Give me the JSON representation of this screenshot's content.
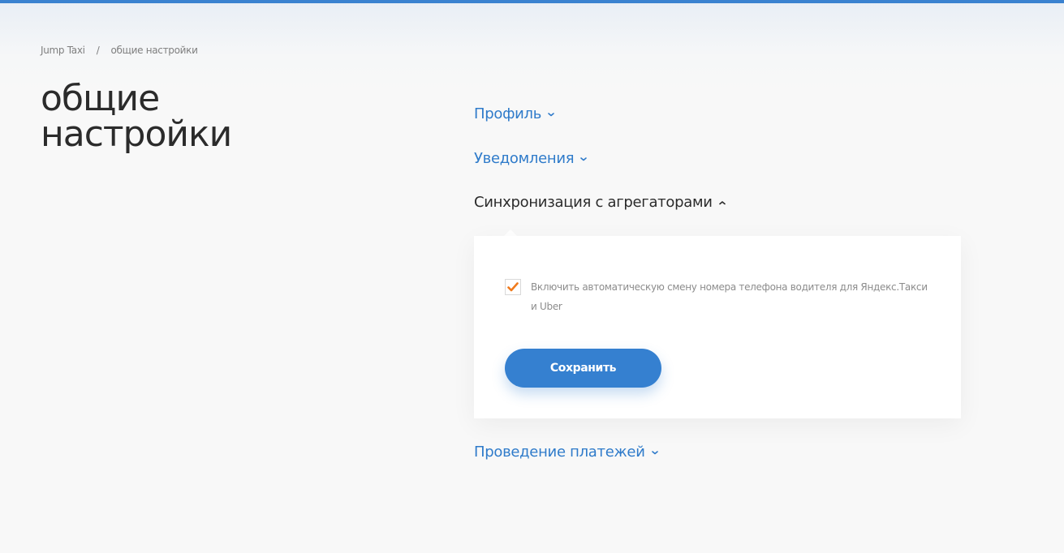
{
  "breadcrumb": {
    "root": "Jump Taxi",
    "separator": "/",
    "current": "общие настройки"
  },
  "page_title": "общие настройки",
  "sections": {
    "profile": {
      "label": "Профиль",
      "icon": "chevron-down-icon"
    },
    "notifications": {
      "label": "Уведомления",
      "icon": "chevron-down-icon"
    },
    "sync": {
      "label": "Синхронизация с агрегаторами",
      "icon": "chevron-up-icon",
      "expanded": true
    },
    "payments": {
      "label": "Проведение платежей",
      "icon": "chevron-down-icon"
    }
  },
  "sync_panel": {
    "checkbox_label": "Включить автоматическую смену номера телефона водителя для Яндекс.Такси и Uber",
    "checkbox_checked": true,
    "save_label": "Сохранить"
  },
  "colors": {
    "accent": "#3580d0",
    "link": "#2f7bca",
    "check": "#f07a1c",
    "top_bar": "#3a82d0"
  }
}
